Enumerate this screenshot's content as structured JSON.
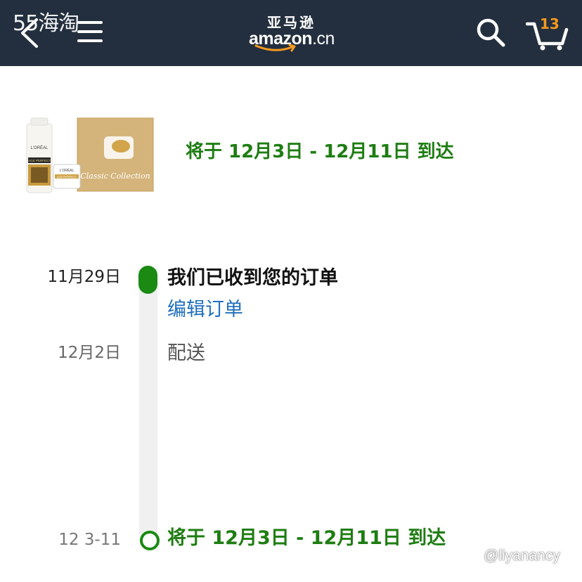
{
  "watermark_top": "55海淘",
  "watermark_bottom": "@liyanancy",
  "header": {
    "logo_cn": "亚马逊",
    "logo_en": "amazon",
    "logo_tld": ".cn",
    "cart_count": "13",
    "colors": {
      "bar": "#232f3e",
      "cart_badge": "#f49a1f",
      "logo_smile": "#f49a1f"
    },
    "icons": [
      "back-arrow-icon",
      "hamburger-menu-icon",
      "search-icon",
      "cart-icon"
    ]
  },
  "product": {
    "image": {
      "brand": "L'ORÉAL",
      "line": "AGE PERFECT",
      "box_title": "Classic Collection"
    },
    "eta": "将于 12月3日 - 12月11日 到达"
  },
  "timeline": {
    "colors": {
      "accent": "#1a8a12",
      "link": "#1f6fbf"
    },
    "events": [
      {
        "date": "11月29日",
        "title": "我们已收到您的订单",
        "link": "编辑订单"
      },
      {
        "date": "12月2日",
        "title": "配送"
      },
      {
        "date": "12 3-11",
        "title": "将于 12月3日 - 12月11日 到达"
      }
    ]
  }
}
